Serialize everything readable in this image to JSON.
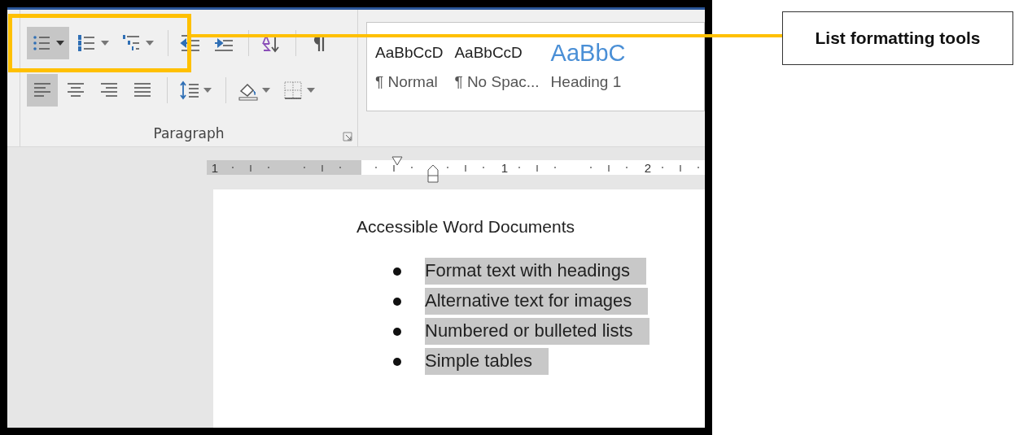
{
  "paragraph_group": {
    "label": "Paragraph",
    "rows": [
      [
        {
          "kind": "bullets",
          "selected": true,
          "dropdown": true
        },
        {
          "kind": "numbering",
          "selected": false,
          "dropdown": true
        },
        {
          "kind": "multilevel",
          "selected": false,
          "dropdown": true
        },
        {
          "kind": "separator"
        },
        {
          "kind": "decrease-indent",
          "selected": false,
          "dropdown": false
        },
        {
          "kind": "increase-indent",
          "selected": false,
          "dropdown": false
        },
        {
          "kind": "separator"
        },
        {
          "kind": "sort",
          "selected": false,
          "dropdown": false
        },
        {
          "kind": "separator"
        },
        {
          "kind": "pilcrow",
          "selected": false,
          "dropdown": false
        }
      ],
      [
        {
          "kind": "align-left",
          "selected": true,
          "dropdown": false
        },
        {
          "kind": "align-center",
          "selected": false,
          "dropdown": false
        },
        {
          "kind": "align-right",
          "selected": false,
          "dropdown": false
        },
        {
          "kind": "justify",
          "selected": false,
          "dropdown": false
        },
        {
          "kind": "separator"
        },
        {
          "kind": "line-spacing",
          "selected": false,
          "dropdown": true
        },
        {
          "kind": "separator"
        },
        {
          "kind": "shading",
          "selected": false,
          "dropdown": true
        },
        {
          "kind": "borders",
          "selected": false,
          "dropdown": true
        }
      ]
    ]
  },
  "styles": [
    {
      "kind": "normal",
      "sample": "AaBbCcD",
      "name": "¶ Normal"
    },
    {
      "kind": "no-spacing",
      "sample": "AaBbCcD",
      "name": "¶ No Spac..."
    },
    {
      "kind": "heading",
      "sample": "AaBbC",
      "name": "Heading 1"
    }
  ],
  "ruler": {
    "numbers": [
      "1",
      "1",
      "2"
    ]
  },
  "document": {
    "title": "Accessible Word Documents",
    "items": [
      {
        "text": "Format text with headings",
        "selected": true
      },
      {
        "text": "Alternative text for images",
        "selected": true
      },
      {
        "text": "Numbered or bulleted lists",
        "selected": true
      },
      {
        "text": "Simple tables",
        "selected": true
      }
    ]
  },
  "callout": {
    "text": "List formatting tools"
  }
}
